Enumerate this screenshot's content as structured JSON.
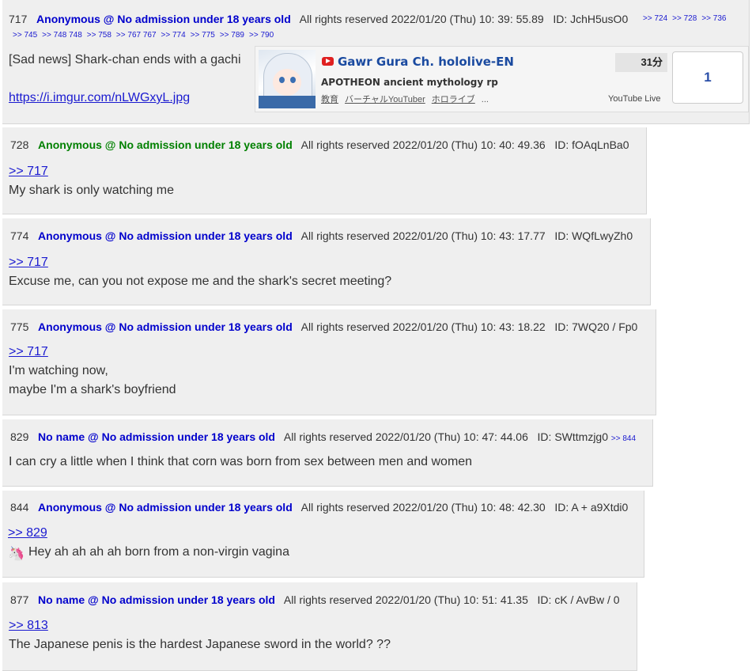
{
  "posts": [
    {
      "num": "717",
      "name": "Anonymous @ No admission under 18 years old",
      "name_color": "#0000cc",
      "date": "All rights reserved 2022/01/20 (Thu) 10: 39: 55.89",
      "id": "ID: JchH5usO0",
      "refs_line1": [
        ">> 724",
        ">> 728",
        ">> 736"
      ],
      "refs_line2": [
        ">> 745",
        ">> 748 748",
        ">> 758",
        ">> 767 767",
        ">> 774",
        ">> 775",
        ">> 789",
        ">> 790"
      ],
      "text": "[Sad news] Shark-chan ends with a gachi",
      "link": "https://i.imgur.com/nLWGxyL.jpg"
    },
    {
      "num": "728",
      "name": "Anonymous @ No admission under 18 years old",
      "name_color": "#008000",
      "date": "All rights reserved 2022/01/20 (Thu) 10: 40: 49.36",
      "id": "ID: fOAqLnBa0",
      "anchor": ">> 717",
      "lines": [
        "My shark is only watching me"
      ]
    },
    {
      "num": "774",
      "name": "Anonymous @ No admission under 18 years old",
      "name_color": "#0000cc",
      "date": "All rights reserved 2022/01/20 (Thu) 10: 43: 17.77",
      "id": "ID: WQfLwyZh0",
      "anchor": ">> 717",
      "lines": [
        "Excuse me, can you not expose me and the shark's secret meeting?"
      ]
    },
    {
      "num": "775",
      "name": "Anonymous @ No admission under 18 years old",
      "name_color": "#0000cc",
      "date": "All rights reserved 2022/01/20 (Thu) 10: 43: 18.22",
      "id": "ID: 7WQ20 / Fp0",
      "anchor": ">> 717",
      "lines": [
        "I'm watching now,",
        "maybe I'm a shark's boyfriend"
      ]
    },
    {
      "num": "829",
      "name": "No name @ No admission under 18 years old",
      "name_color": "#0000cc",
      "date": "All rights reserved 2022/01/20 (Thu) 10: 47: 44.06",
      "id": "ID: SWttmzjg0",
      "refs_inline": ">> 844",
      "lines": [
        "I can cry a little when I think that corn was born from sex between men and women"
      ]
    },
    {
      "num": "844",
      "name": "Anonymous @ No admission under 18 years old",
      "name_color": "#0000cc",
      "date": "All rights reserved 2022/01/20 (Thu) 10: 48: 42.30",
      "id": "ID: A + a9Xtdi0",
      "anchor": ">> 829",
      "lines": [
        "Hey ah ah ah ah born from a non-virgin vagina"
      ],
      "emoji_icon": "unicorn-icon"
    },
    {
      "num": "877",
      "name": "No name @ No admission under 18 years old",
      "name_color": "#0000cc",
      "date": "All rights reserved 2022/01/20 (Thu) 10: 51: 41.35",
      "id": "ID: cK / AvBw / 0",
      "anchor": ">> 813",
      "lines": [
        "The Japanese penis is the hardest Japanese sword in the world? ??"
      ]
    }
  ],
  "embed": {
    "channel": "Gawr Gura Ch. hololive-EN",
    "duration": "31分",
    "video_title": "APOTHEON ancient mythology rp",
    "tags": [
      "教育",
      "バーチャルYouTuber",
      "ホロライブ",
      "..."
    ],
    "platform": "YouTube Live",
    "count": "1",
    "platform_icon": "youtube-icon"
  }
}
